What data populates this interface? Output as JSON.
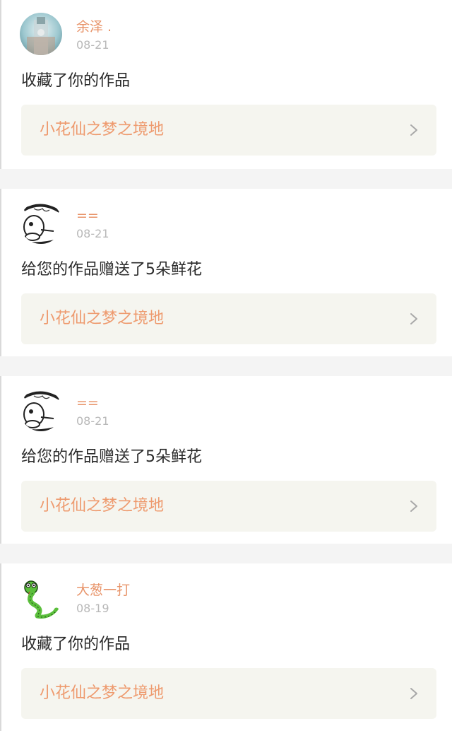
{
  "feed": {
    "items": [
      {
        "avatar_icon": "avatar-photo-icon",
        "username": "余泽 .",
        "date": "08-21",
        "action": "收藏了你的作品",
        "work_title": "小花仙之梦之境地",
        "chevron_icon": "chevron-right-icon"
      },
      {
        "avatar_icon": "avatar-sketch-icon",
        "username": "==",
        "date": "08-21",
        "action": "给您的作品赠送了5朵鲜花",
        "work_title": "小花仙之梦之境地",
        "chevron_icon": "chevron-right-icon"
      },
      {
        "avatar_icon": "avatar-sketch-icon",
        "username": "==",
        "date": "08-21",
        "action": "给您的作品赠送了5朵鲜花",
        "work_title": "小花仙之梦之境地",
        "chevron_icon": "chevron-right-icon"
      },
      {
        "avatar_icon": "avatar-snake-icon",
        "username": "大葱一打",
        "date": "08-19",
        "action": "收藏了你的作品",
        "work_title": "小花仙之梦之境地",
        "chevron_icon": "chevron-right-icon"
      }
    ]
  },
  "colors": {
    "username": "#e8946a",
    "work_title": "#ee9a6e",
    "date": "#b8b8b8",
    "action_text": "#2a2a2a",
    "link_background": "#f5f5ef",
    "separator": "#f4f4f4"
  }
}
